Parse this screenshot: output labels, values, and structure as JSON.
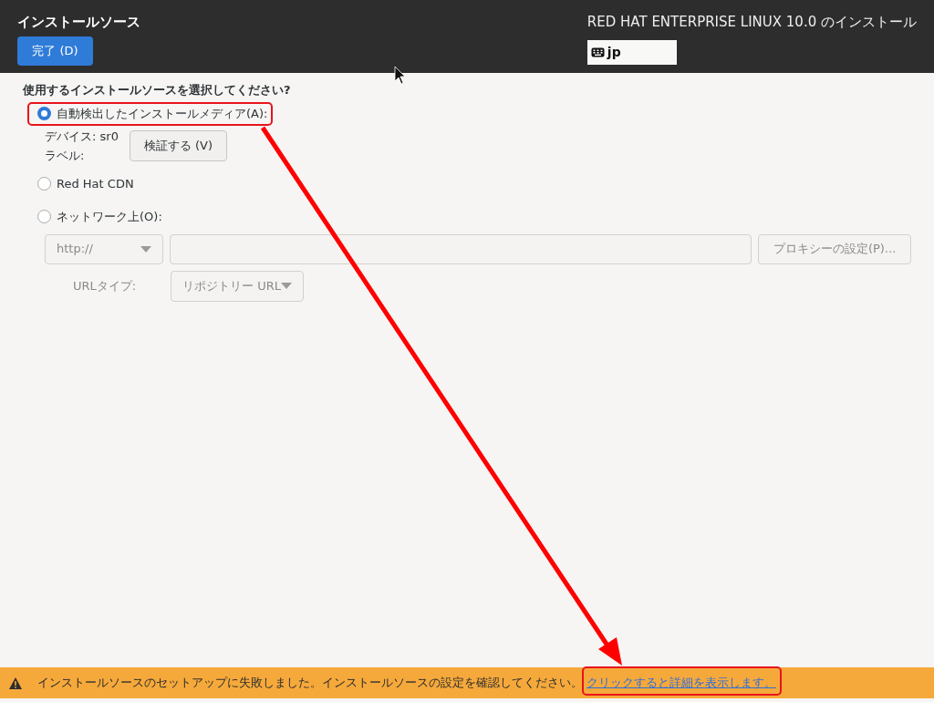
{
  "header": {
    "title": "インストールソース",
    "done_button": "完了 (D)",
    "product_title": "RED HAT ENTERPRISE LINUX 10.0 のインストール",
    "keyboard_layout": "jp"
  },
  "question": "使用するインストールソースを選択してください?",
  "sources": [
    {
      "label": "自動検出したインストールメディア(A):",
      "selected": true,
      "highlighted": true
    },
    {
      "label": "Red Hat CDN",
      "selected": false,
      "highlighted": false
    },
    {
      "label": "ネットワーク上(O):",
      "selected": false,
      "highlighted": false
    }
  ],
  "media": {
    "device": "デバイス: sr0",
    "label": "ラベル:",
    "verify_button": "検証する (V)"
  },
  "network": {
    "disabled": true,
    "protocol": "http://",
    "proxy_button": "プロキシーの設定(P)...",
    "url_type_label": "URLタイプ:",
    "url_type": "リポジトリー URL"
  },
  "warning_bar": {
    "message": "インストールソースのセットアップに失敗しました。インストールソースの設定を確認してください。",
    "link": "クリックすると詳細を表示します。",
    "link_highlighted": true
  }
}
